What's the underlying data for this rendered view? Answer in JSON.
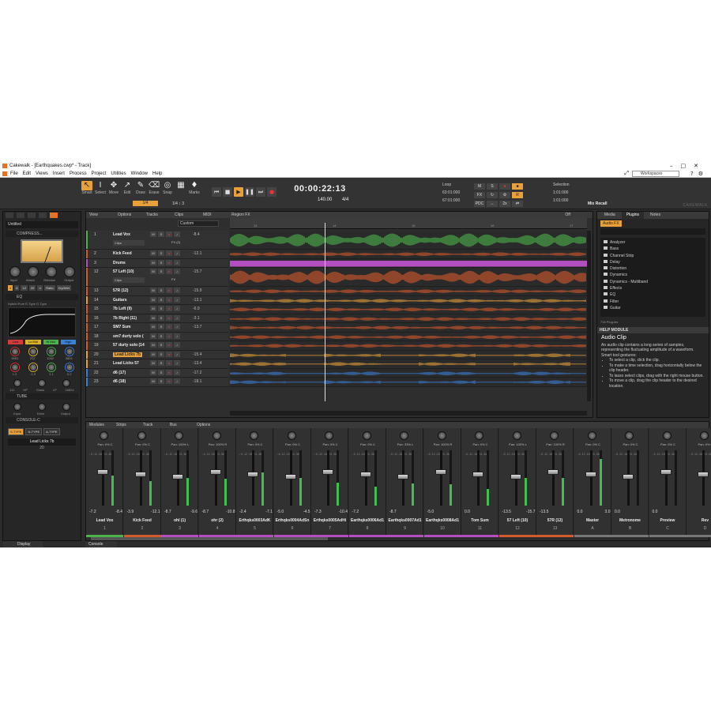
{
  "window": {
    "title": "Cakewalk - [Earthquakes.cwp* - Track]"
  },
  "menu": [
    "File",
    "Edit",
    "Views",
    "Insert",
    "Process",
    "Project",
    "Utilities",
    "Window",
    "Help"
  ],
  "workspace": "Workspaces",
  "tools": [
    {
      "label": "Smart",
      "icon": "↖"
    },
    {
      "label": "Select",
      "icon": "I"
    },
    {
      "label": "Move",
      "icon": "✥"
    },
    {
      "label": "Edit",
      "icon": "↗"
    },
    {
      "label": "Draw",
      "icon": "✎"
    },
    {
      "label": "Erase",
      "icon": "⌫"
    },
    {
      "label": "Snap",
      "icon": "◎"
    },
    {
      "label": "",
      "icon": "▦"
    },
    {
      "label": "Marks",
      "icon": "♦"
    }
  ],
  "snap": {
    "value": "1/4",
    "quant": "1/4",
    "count": "3"
  },
  "transport": {
    "time": "00:00:22:13",
    "tempo": "140.00",
    "meter": "4/4"
  },
  "loop": {
    "label": "Loop",
    "start": "63:01:000",
    "end": "67:01:000"
  },
  "modes": [
    "M",
    "S",
    "●",
    "■",
    "FX",
    "↻",
    "⚙",
    "R",
    "PDC",
    "↔",
    "2x",
    "⇄"
  ],
  "selection": {
    "label": "Selection",
    "start": "1:01:000",
    "end": "1:01:000"
  },
  "mix_recall": "Mix Recall",
  "logo": "CAKEWALK",
  "inspector": {
    "preset": "Untitled",
    "comp_header": "COMPRESS...",
    "comp_knobs": [
      "Input",
      "Attack",
      "Release",
      "Output"
    ],
    "ratio_label": "Ratio",
    "ratios": [
      "4",
      "8",
      "12",
      "20",
      "∞"
    ],
    "drywet": "Dry/Wet",
    "eq_header": "EQ",
    "eq_opts": "Hybrid  Pure  E-Type  G-Type",
    "eq_bands": [
      {
        "label": "Low",
        "color": "#d33b3b"
      },
      {
        "label": "Lo Mid",
        "color": "#d9b32a"
      },
      {
        "label": "Hi Mid",
        "color": "#4db34d"
      },
      {
        "label": "High",
        "color": "#3a7fd9"
      }
    ],
    "eq_vals": [
      "3951",
      "222",
      "1262",
      "3824"
    ],
    "eq_gains": [
      "1.3",
      "-1.9",
      "1.1",
      "0.2"
    ],
    "hp": "HP",
    "lp": "LP",
    "gloss": "Gloss",
    "hp_val": "111",
    "lp_val": "16824",
    "tube_header": "TUBE",
    "tube_knobs": [
      "Input",
      "Drive",
      "Output"
    ],
    "console_header": "CONSOLE-C",
    "types": [
      "S-TYPE",
      "N-TYPE",
      "A-TYPE"
    ],
    "strip_name": "Lead Licks 7b",
    "strip_num": "20",
    "bottom_tab": "Display"
  },
  "trackview": {
    "menus": [
      "View",
      "Options",
      "Tracks",
      "Clips",
      "MIDI",
      "Region FX"
    ],
    "off": "Off",
    "custom": "Custom",
    "ruler": [
      "13",
      "14",
      "15",
      "16",
      "17"
    ],
    "tracks": [
      {
        "num": "1",
        "name": "Lead Vox",
        "vol": "-8.4",
        "color": "#4db34d",
        "clips": "Clips",
        "fx": "FX (2)"
      },
      {
        "num": "2",
        "name": "Kick Feed",
        "vol": "-12.1",
        "color": "#d35a2a"
      },
      {
        "num": "3",
        "name": "Drums",
        "vol": "",
        "color": "#b44fc0"
      },
      {
        "num": "12",
        "name": "57 Left (10)",
        "vol": "-15.7",
        "color": "#d35a2a",
        "clips": "Clips",
        "fx": "FX"
      },
      {
        "num": "13",
        "name": "57R (12)",
        "vol": "-15.9",
        "color": "#d35a2a"
      },
      {
        "num": "14",
        "name": "Guitars",
        "vol": "-13.1",
        "color": "#e8a13a"
      },
      {
        "num": "15",
        "name": "7b Left (9)",
        "vol": "-6.9",
        "color": "#d35a2a"
      },
      {
        "num": "16",
        "name": "7b Right (11)",
        "vol": "-3.1",
        "color": "#d35a2a"
      },
      {
        "num": "17",
        "name": "SM7 Sum",
        "vol": "-13.7",
        "color": "#d35a2a"
      },
      {
        "num": "18",
        "name": "sm7 durty solo (",
        "vol": "",
        "color": "#d35a2a"
      },
      {
        "num": "19",
        "name": "57 durty solo (14",
        "vol": "",
        "color": "#d35a2a"
      },
      {
        "num": "20",
        "name": "Lead Licks 7b",
        "vol": "-15.4",
        "color": "#e8a13a"
      },
      {
        "num": "21",
        "name": "Lead Licks 57",
        "vol": "-13.4",
        "color": "#e8a13a"
      },
      {
        "num": "22",
        "name": "d6 (17)",
        "vol": "-17.2",
        "color": "#3a7fd9"
      },
      {
        "num": "23",
        "name": "d6 (18)",
        "vol": "-18.1",
        "color": "#3a7fd9"
      }
    ]
  },
  "browser": {
    "tabs": [
      "Media",
      "Plugins",
      "Notes"
    ],
    "audio_fx": "Audio FX",
    "categories": [
      "Analyzer",
      "Bass",
      "Channel Strip",
      "Delay",
      "Distortion",
      "Dynamics",
      "Dynamics - Multiband",
      "Effects",
      "EQ",
      "Filter",
      "Guitar"
    ],
    "count": "718 Plug-ins",
    "help_header": "HELP MODULE",
    "help_title": "Audio Clip",
    "help_text": "An audio clip contains a long series of samples, representing the fluctuating amplitude of a waveform.",
    "help_sub": "Smart tool gestures:",
    "help_items": [
      "To select a clip, click the clip.",
      "To make a time selection, drag horizontally below the clip header.",
      "To lasso select clips, drag with the right mouse button.",
      "To move a clip, drag the clip header to the desired location."
    ]
  },
  "console": {
    "menus": [
      "Modules",
      "Strips",
      "Track",
      "Bus",
      "Options"
    ],
    "bottom_tab": "Console",
    "strips": [
      {
        "name": "Lead Vox",
        "num": "1",
        "pan": "Pan: 0% C",
        "v1": "-7.2",
        "v2": "-8.4",
        "color": "#4db34d",
        "level": 0.55
      },
      {
        "name": "Kick Feed",
        "num": "2",
        "pan": "Pan: 0% C",
        "v1": "-3.9",
        "v2": "-12.1",
        "color": "#d35a2a",
        "level": 0.45
      },
      {
        "name": "ohl (1)",
        "num": "3",
        "pan": "Pan: 100% L",
        "v1": "-8.7",
        "v2": "-9.6",
        "color": "#b44fc0",
        "level": 0.5
      },
      {
        "name": "ohr (2)",
        "num": "4",
        "pan": "Pan: 100% R",
        "v1": "-8.7",
        "v2": "-10.8",
        "color": "#b44fc0",
        "level": 0.48
      },
      {
        "name": "Erthqks0003AdK",
        "num": "5",
        "pan": "Pan: 0% C",
        "v1": "-2.4",
        "v2": "-7.1",
        "color": "#b44fc0",
        "level": 0.6
      },
      {
        "name": "Erthqks0004AdSn",
        "num": "6",
        "pan": "Pan: 0% C",
        "v1": "-5.0",
        "v2": "-4.5",
        "color": "#b44fc0",
        "level": 0.5
      },
      {
        "name": "Erthqks0005AdHi",
        "num": "7",
        "pan": "Pan: 0% C",
        "v1": "-7.3",
        "v2": "-10.4",
        "color": "#b44fc0",
        "level": 0.42
      },
      {
        "name": "Earthqks0006Ad1",
        "num": "8",
        "pan": "Pan: 0% C",
        "v1": "-7.2",
        "v2": "",
        "color": "#b44fc0",
        "level": 0.35
      },
      {
        "name": "Earthqks0007Ad1",
        "num": "9",
        "pan": "Pan: 33% L",
        "v1": "-8.7",
        "v2": "",
        "color": "#b44fc0",
        "level": 0.4
      },
      {
        "name": "Earthqks0008Ad1",
        "num": "10",
        "pan": "Pan: 100% R",
        "v1": "-5.0",
        "v2": "",
        "color": "#b44fc0",
        "level": 0.38
      },
      {
        "name": "Tom Sum",
        "num": "11",
        "pan": "Pan: 0% C",
        "v1": "0.0",
        "v2": "",
        "color": "#b44fc0",
        "level": 0.3
      },
      {
        "name": "57 Left (10)",
        "num": "12",
        "pan": "Pan: 100% L",
        "v1": "-13.5",
        "v2": "-15.7",
        "color": "#d35a2a",
        "level": 0.5
      },
      {
        "name": "57R (12)",
        "num": "13",
        "pan": "Pan: 100% R",
        "v1": "-13.5",
        "v2": "",
        "color": "#d35a2a",
        "level": 0.5
      },
      {
        "name": "Master",
        "num": "A",
        "pan": "Pan: 0% C",
        "v1": "0.0",
        "v2": "3.0",
        "color": "#777777",
        "level": 0.85
      },
      {
        "name": "Metronome",
        "num": "B",
        "pan": "Pan: 0% C",
        "v1": "0.0",
        "v2": "",
        "color": "#777777",
        "level": 0.0
      },
      {
        "name": "Preview",
        "num": "C",
        "pan": "Pan: 0% C",
        "v1": "0.0",
        "v2": "",
        "color": "#777777",
        "level": 0.0
      },
      {
        "name": "Rev",
        "num": "D",
        "pan": "Pan: 0% C",
        "v1": "",
        "v2": "",
        "color": "#777777",
        "level": 0.0
      }
    ]
  }
}
